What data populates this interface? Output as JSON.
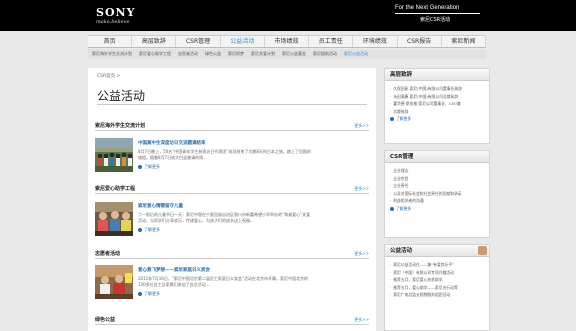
{
  "header": {
    "logo": "SONY",
    "logo_tagline": "make.believe",
    "slogan": "For the Next Generation",
    "slogan_sub": "索尼CSR活动"
  },
  "nav": {
    "items": [
      "首页",
      "高层致辞",
      "CSR管理",
      "公益活动",
      "市场绩效",
      "员工责任",
      "环境绩效",
      "CSR报告",
      "索尼新闻"
    ],
    "active_index": 3,
    "sub_items": [
      "索尼海外学生交流计划",
      "索尼爱心助学工程",
      "志愿者活动",
      "绿色公益",
      "索尼探梦",
      "索尼关爱计划",
      "索尼公益基金",
      "索尼援助活动",
      "索尼公益活动"
    ],
    "sub_active_index": 8
  },
  "main": {
    "breadcrumb": "CSR首页 >",
    "title": "公益活动",
    "sections": [
      {
        "title": "索尼海外学生交流计划",
        "more": "更多>>",
        "article_title": "中国高中生深度访日交流圆满结束",
        "article_desc_1": "8月7日晚上，50名“中国青年学生参观访日代表团”成员结束了为期8天的日本之旅，踏上了回国的",
        "article_desc_2": "旅程。随着8月7日成大巴返被请的线...",
        "learn_more": "了解更多"
      },
      {
        "title": "索尼爱心助学工程",
        "more": "更多>>",
        "article_title": "索尼爱心情暖留守儿童",
        "article_desc_1": "六一前后的儿童节日一天，索尼中国在宁夏回族自治区银川市新蕾希望小学举办的“和谐爱心”关爱",
        "article_desc_2": "活动，与同学们分享欢乐，传递爱心，为孩子们的成长送上祝福...",
        "learn_more": "了解更多"
      },
      {
        "title": "志愿者活动",
        "more": "更多>>",
        "article_title": "爱心救飞梦想——索尼家庭日义卖会",
        "article_desc_1": "2011年7月16日，“索尼中国北京第二届员工家庭日义卖会”活动在北京市开幕，索尼中国北京的",
        "article_desc_2": "130多位员工及家属们参加了此次活动...",
        "learn_more": "了解更多"
      },
      {
        "title": "绿色公益",
        "more": "更多>>"
      }
    ]
  },
  "sidebar": {
    "boxes": [
      {
        "title": "高层致辞",
        "items": [
          "久保田彰 索尼(中国)有限公司董事长致辞",
          "永田满康 索尼(中国)有限公司总裁致辞",
          "霍华德·斯金格 索尼公司董事长、CEO兼",
          "总裁致辞"
        ],
        "more": "了解更多"
      },
      {
        "title": "CSR管理",
        "items": [
          "企业理念",
          "企业宗旨",
          "企业责任",
          "以及对国际社会和社会责任的贡献和承诺",
          "利益相关者的沟通"
        ],
        "more": "了解更多"
      },
      {
        "title": "公益活动",
        "items": [
          "索尼公益活动在——像“有爱其乐平”",
          "索尼（中国）有限公司专项兴趣活动",
          "推荐五月，索尼爱心扶贫助学",
          "推荐五月，爱心助学——索尼光行动等",
          "索尼广电总监五视频服务组团活动"
        ],
        "more": ""
      }
    ]
  },
  "colors": {
    "accent": "#2a8fd8",
    "link": "#2a6ea8",
    "header_bg": "#000000",
    "page_bg": "#e9e9e9"
  }
}
